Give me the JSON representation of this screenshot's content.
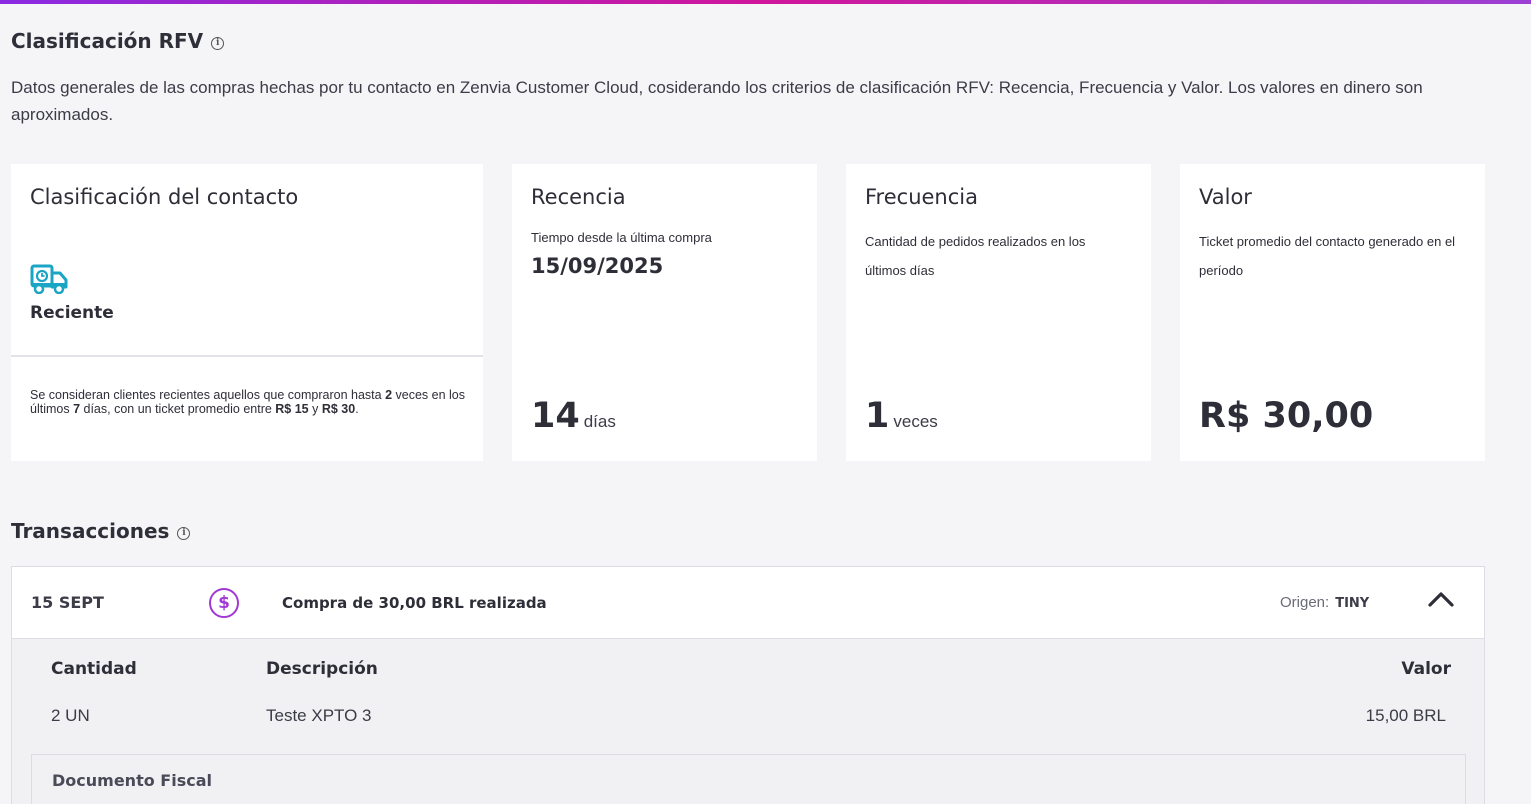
{
  "colors": {
    "accent": "#a238d6",
    "truck": "#1aa5c5",
    "gradient_start": "#8a2be2",
    "gradient_end": "#d0169a"
  },
  "rfv": {
    "title": "Clasificación RFV",
    "info_icon": "info-icon",
    "description": "Datos generales de las compras hechas por tu contacto en Zenvia Customer Cloud, cosiderando los criterios de clasificación RFV: Recencia, Frecuencia y Valor. Los valores en dinero son aproximados."
  },
  "classification": {
    "title": "Clasificación del contacto",
    "icon": "delivery-truck-clock-icon",
    "label": "Reciente",
    "note": {
      "p1": "Se consideran clientes recientes aquellos que compraron hasta ",
      "n1": "2",
      "p2": " veces en los últimos ",
      "n2": "7",
      "p3": " días, con un ticket promedio entre ",
      "n3": "R$ 15",
      "p4": " y ",
      "n4": "R$ 30",
      "p5": "."
    }
  },
  "recencia": {
    "title": "Recencia",
    "subtitle": "Tiempo desde la última compra",
    "date": "15/09/2025",
    "value": "14",
    "unit": "días"
  },
  "frecuencia": {
    "title": "Frecuencia",
    "subtitle": "Cantidad de pedidos realizados en los últimos días",
    "value": "1",
    "unit": "veces"
  },
  "valor": {
    "title": "Valor",
    "subtitle": "Ticket promedio del contacto generado en el período",
    "value": "R$ 30,00"
  },
  "transactions": {
    "title": "Transacciones",
    "info_icon": "info-icon",
    "items": [
      {
        "date": "15 SEPT",
        "icon": "dollar-circle-icon",
        "text": "Compra de 30,00 BRL realizada",
        "origin_label": "Origen:",
        "origin_value": "TINY",
        "toggle_icon": "chevron-up-icon",
        "columns": {
          "qty": "Cantidad",
          "desc": "Descripción",
          "value": "Valor"
        },
        "rows": [
          {
            "qty": "2 UN",
            "desc": "Teste XPTO 3",
            "value": "15,00 BRL"
          }
        ],
        "fiscal_title": "Documento Fiscal"
      }
    ]
  }
}
